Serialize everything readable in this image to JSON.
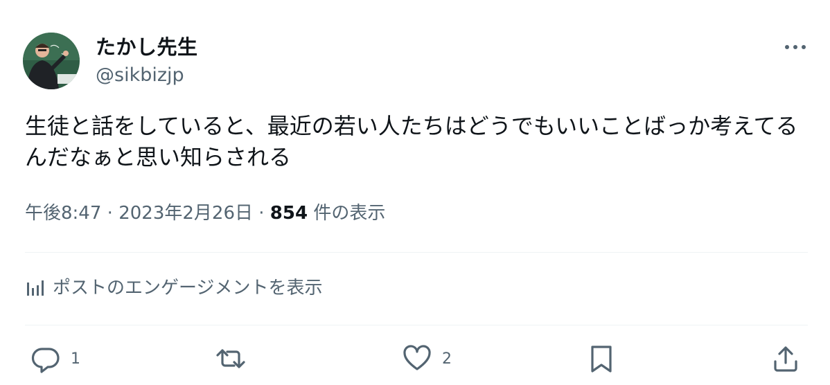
{
  "user": {
    "display_name": "たかし先生",
    "handle": "@sikbizjp"
  },
  "post": {
    "text": "生徒と話をしていると、最近の若い人たちはどうでもいいことばっか考えてるんだなぁと思い知らされる",
    "time": "午後8:47",
    "date": "2023年2月26日",
    "separator": "·",
    "views_count": "854",
    "views_label": "件の表示"
  },
  "engagement_link": {
    "label": "ポストのエンゲージメントを表示"
  },
  "actions": {
    "reply_count": "1",
    "repost_count": "",
    "like_count": "2"
  },
  "colors": {
    "text": "#0f1419",
    "secondary": "#536471",
    "divider": "#eff3f4"
  },
  "icons": [
    "avatar",
    "more-icon",
    "chart-icon",
    "reply-icon",
    "repost-icon",
    "like-icon",
    "bookmark-icon",
    "share-icon"
  ]
}
